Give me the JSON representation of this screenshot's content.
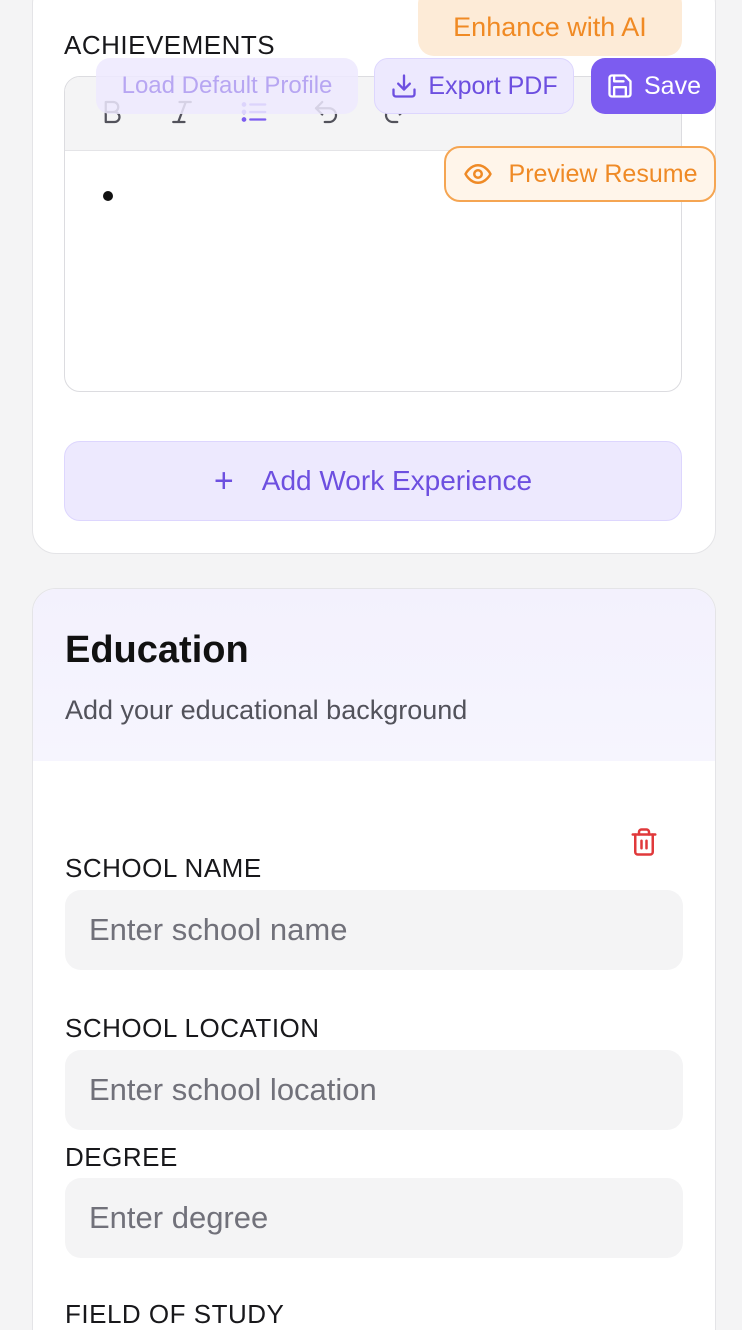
{
  "achievements": {
    "label": "ACHIEVEMENTS",
    "toolbar": [
      "bold-icon",
      "italic-icon",
      "bullet-list-icon",
      "undo-icon",
      "redo-icon"
    ]
  },
  "add_work_label": "Add Work Experience",
  "actions": {
    "enhance": "Enhance with AI",
    "load_default": "Load Default Profile",
    "export_pdf": "Export PDF",
    "save": "Save",
    "preview": "Preview Resume"
  },
  "education": {
    "title": "Education",
    "subtitle": "Add your educational background",
    "fields": {
      "school_name": {
        "label": "SCHOOL NAME",
        "placeholder": "Enter school name",
        "value": ""
      },
      "school_location": {
        "label": "SCHOOL LOCATION",
        "placeholder": "Enter school location",
        "value": ""
      },
      "degree": {
        "label": "DEGREE",
        "placeholder": "Enter degree",
        "value": ""
      },
      "field_of_study": {
        "label": "FIELD OF STUDY"
      }
    }
  },
  "colors": {
    "accent": "#7c5cf0",
    "accent_light": "#ede9fe",
    "orange": "#ef8a26",
    "danger": "#e0393b"
  }
}
